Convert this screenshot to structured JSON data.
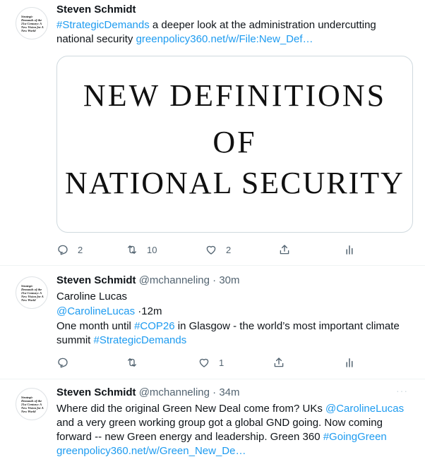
{
  "tweets": [
    {
      "avatar_text": "Strategic Demands of the 21st Century: A New Vision for A New World",
      "name": "Steven Schmidt",
      "handle": "",
      "time": "",
      "body_parts": [
        {
          "text": "#StrategicDemands",
          "link": true
        },
        {
          "text": " a deeper look at the administration undercutting national security ",
          "link": false
        },
        {
          "text": "greenpolicy360.net/w/File:New_Def…",
          "link": true
        }
      ],
      "media": {
        "line1": "NEW DEFINITIONS",
        "line2": "OF",
        "line3": "NATIONAL SECURITY"
      },
      "actions": {
        "reply": "2",
        "retweet": "10",
        "like": "2"
      }
    },
    {
      "avatar_text": "Strategic Demands of the 21st Century: A New Vision for A New World",
      "name": "Steven Schmidt",
      "handle": "@mchanneling",
      "time": "· 30m",
      "lines": [
        [
          {
            "text": "Caroline Lucas",
            "link": false
          }
        ],
        [
          {
            "text": "@CarolineLucas",
            "link": true
          },
          {
            "text": " ·12m",
            "link": false
          }
        ],
        [
          {
            "text": "One month until ",
            "link": false
          },
          {
            "text": "#COP26",
            "link": true
          },
          {
            "text": " in Glasgow - the world’s most important climate summit  ",
            "link": false
          },
          {
            "text": "#StrategicDemands",
            "link": true
          }
        ]
      ],
      "actions": {
        "reply": "",
        "retweet": "",
        "like": "1"
      }
    },
    {
      "avatar_text": "Strategic Demands of the 21st Century: A New Vision for A New World",
      "name": "Steven Schmidt",
      "handle": "@mchanneling",
      "time": "· 34m",
      "more": "···",
      "body_parts": [
        {
          "text": "Where did the original Green New Deal come from? UKs ",
          "link": false
        },
        {
          "text": "@CarolineLucas",
          "link": true
        },
        {
          "text": " and a very green working group got a global GND going. Now coming forward -- new Green energy and leadership. Green 360 ",
          "link": false
        },
        {
          "text": "#GoingGreen",
          "link": true
        },
        {
          "text": " ",
          "link": false
        },
        {
          "text": "greenpolicy360.net/w/Green_New_De…",
          "link": true
        }
      ]
    }
  ],
  "colors": {
    "link": "#1d9bf0",
    "muted": "#536471",
    "text": "#0f1419",
    "divider": "#eff3f4"
  },
  "icons": [
    "reply-icon",
    "retweet-icon",
    "like-icon",
    "share-icon",
    "analytics-icon"
  ]
}
